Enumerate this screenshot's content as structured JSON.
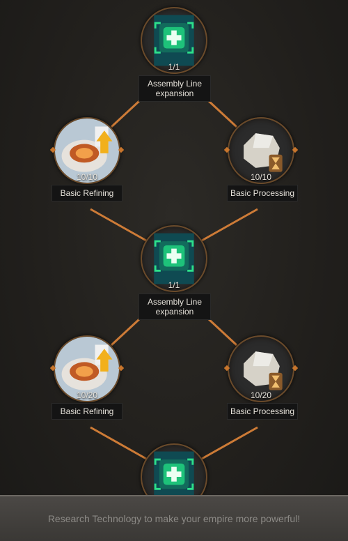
{
  "tree": {
    "nodes": [
      {
        "id": "assembly-1",
        "kind": "assembly",
        "count": "1/1",
        "label": "Assembly Line expansion"
      },
      {
        "id": "refining-1",
        "kind": "refining",
        "count": "10/10",
        "label": "Basic Refining"
      },
      {
        "id": "processing-1",
        "kind": "processing",
        "count": "10/10",
        "label": "Basic Processing"
      },
      {
        "id": "assembly-2",
        "kind": "assembly",
        "count": "1/1",
        "label": "Assembly Line expansion"
      },
      {
        "id": "refining-2",
        "kind": "refining",
        "count": "10/20",
        "label": "Basic Refining"
      },
      {
        "id": "processing-2",
        "kind": "processing",
        "count": "10/20",
        "label": "Basic Processing"
      },
      {
        "id": "assembly-3",
        "kind": "assembly",
        "count": "",
        "label": ""
      }
    ],
    "icons": {
      "assembly": "green-plus-assembly-icon",
      "refining": "refinery-upgrade-icon",
      "processing": "stone-hourglass-icon"
    },
    "link_color": "#e0853a"
  },
  "footer": {
    "text": "Research Technology to make your empire more powerful!"
  }
}
